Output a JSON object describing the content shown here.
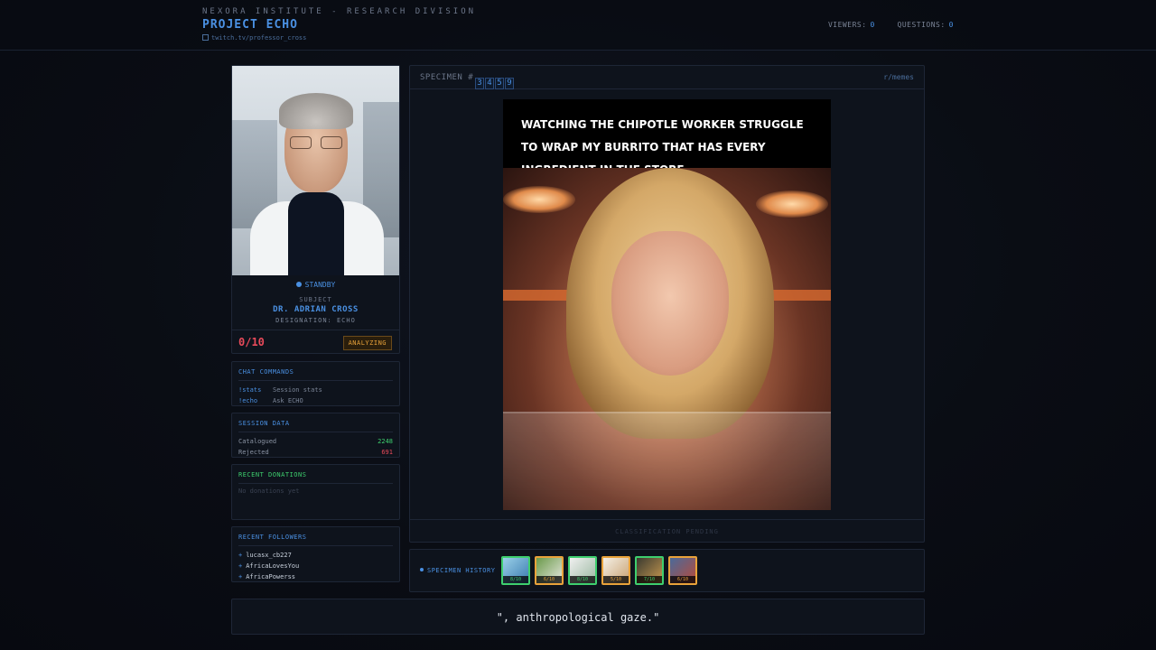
{
  "header": {
    "org": "NEXORA INSTITUTE - RESEARCH DIVISION",
    "project": "PROJECT ECHO",
    "channel": "twitch.tv/professor_cross",
    "viewers_label": "VIEWERS:",
    "viewers": "0",
    "questions_label": "QUESTIONS:",
    "questions": "0"
  },
  "profile": {
    "status": "STANDBY",
    "subject_label": "SUBJECT",
    "name": "DR. ADRIAN CROSS",
    "designation": "DESIGNATION: ECHO",
    "score": "0/10",
    "state": "ANALYZING"
  },
  "commands": {
    "title": "CHAT COMMANDS",
    "items": [
      {
        "cmd": "!stats",
        "desc": "Session stats"
      },
      {
        "cmd": "!echo",
        "desc": "Ask ECHO"
      }
    ]
  },
  "session": {
    "title": "SESSION DATA",
    "catalogued_label": "Catalogued",
    "catalogued": "2248",
    "rejected_label": "Rejected",
    "rejected": "691"
  },
  "donations": {
    "title": "RECENT DONATIONS",
    "empty": "No donations yet"
  },
  "followers": {
    "title": "RECENT FOLLOWERS",
    "items": [
      "lucasx_cb227",
      "AfricaLovesYou",
      "AfricaPowerss"
    ]
  },
  "specimen": {
    "label": "SPECIMEN #",
    "digits": [
      "3",
      "4",
      "5",
      "9"
    ],
    "source": "r/memes",
    "caption": "WATCHING THE CHIPOTLE WORKER STRUGGLE TO WRAP MY BURRITO THAT HAS EVERY INGREDIENT IN THE STORE",
    "classification": "CLASSIFICATION PENDING"
  },
  "history": {
    "label": "SPECIMEN HISTORY",
    "items": [
      {
        "score": "8/10",
        "tone": "green",
        "color": "#3ecf6e"
      },
      {
        "score": "6/10",
        "tone": "orange",
        "color": "#e8a23a"
      },
      {
        "score": "8/10",
        "tone": "green",
        "color": "#3ecf6e"
      },
      {
        "score": "5/10",
        "tone": "orange",
        "color": "#e8a23a"
      },
      {
        "score": "7/10",
        "tone": "green",
        "color": "#3ecf6e"
      },
      {
        "score": "6/10",
        "tone": "orange",
        "color": "#e8a23a"
      }
    ]
  },
  "quote": "\", anthropological gaze.\"",
  "colors": {
    "accent": "#4a90e2",
    "positive": "#3ecf6e",
    "negative": "#e84a5a",
    "warning": "#e8a23a",
    "background": "#0a0d14"
  }
}
